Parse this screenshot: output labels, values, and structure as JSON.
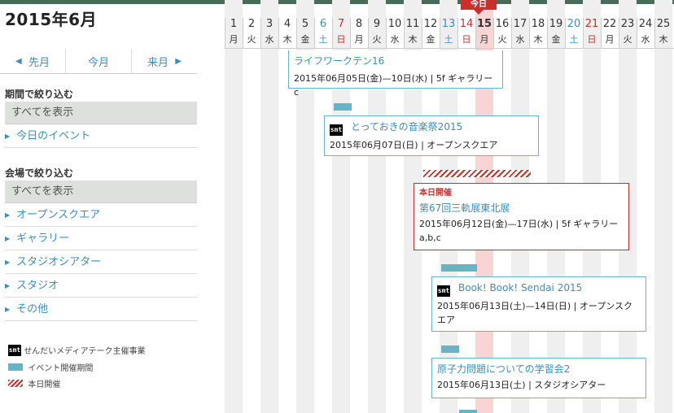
{
  "header": {
    "month_title": "2015年6月"
  },
  "month_nav": {
    "prev": "先月",
    "current": "今月",
    "next": "来月"
  },
  "filters": {
    "period": {
      "title": "期間で絞り込む",
      "show_all": "すべてを表示",
      "items": [
        "今日のイベント"
      ]
    },
    "venue": {
      "title": "会場で絞り込む",
      "show_all": "すべてを表示",
      "items": [
        "オープンスクエア",
        "ギャラリー",
        "スタジオシアター",
        "スタジオ",
        "その他"
      ]
    }
  },
  "legend": {
    "smt_mark": "smt",
    "smt_label": "せんだいメディアテーク主催事業",
    "bar_label": "イベント開催期間",
    "stripe_label": "本日開催"
  },
  "calendar": {
    "today_label": "今日",
    "days": [
      {
        "d": "1",
        "w": "月"
      },
      {
        "d": "2",
        "w": "火"
      },
      {
        "d": "3",
        "w": "水"
      },
      {
        "d": "4",
        "w": "木"
      },
      {
        "d": "5",
        "w": "金"
      },
      {
        "d": "6",
        "w": "土"
      },
      {
        "d": "7",
        "w": "日"
      },
      {
        "d": "8",
        "w": "月"
      },
      {
        "d": "9",
        "w": "火"
      },
      {
        "d": "10",
        "w": "水"
      },
      {
        "d": "11",
        "w": "木"
      },
      {
        "d": "12",
        "w": "金"
      },
      {
        "d": "13",
        "w": "土"
      },
      {
        "d": "14",
        "w": "日"
      },
      {
        "d": "15",
        "w": "月"
      },
      {
        "d": "16",
        "w": "火"
      },
      {
        "d": "17",
        "w": "水"
      },
      {
        "d": "18",
        "w": "木"
      },
      {
        "d": "19",
        "w": "金"
      },
      {
        "d": "20",
        "w": "土"
      },
      {
        "d": "21",
        "w": "日"
      },
      {
        "d": "22",
        "w": "月"
      },
      {
        "d": "23",
        "w": "火"
      },
      {
        "d": "24",
        "w": "水"
      },
      {
        "d": "25",
        "w": "木"
      }
    ],
    "colors": {
      "saturday": "#3a8ebc",
      "sunday": "#c9302c",
      "today": "#c9302c",
      "bar": "#65b5c7"
    }
  },
  "events": [
    {
      "title": "ライフワークテン16",
      "dates": "2015年06月05日(金)—10日(水) | 5f ギャラリーc",
      "smt": false
    },
    {
      "title": "とっておきの音楽祭2015",
      "dates": "2015年06月07日(日) | オープンスクエア",
      "smt": true
    },
    {
      "badge": "本日開催",
      "title": "第67回三軌展東北展",
      "dates": "2015年06月12日(金)—17日(水) | 5f ギャラリーa,b,c",
      "smt": false
    },
    {
      "title": "Book! Book! Sendai 2015",
      "dates": "2015年06月13日(土)—14日(日) | オープンスクエア",
      "smt": true
    },
    {
      "title": "原子力問題についての学習会2",
      "dates": "2015年06月13日(土) | スタジオシアター",
      "smt": false
    }
  ]
}
